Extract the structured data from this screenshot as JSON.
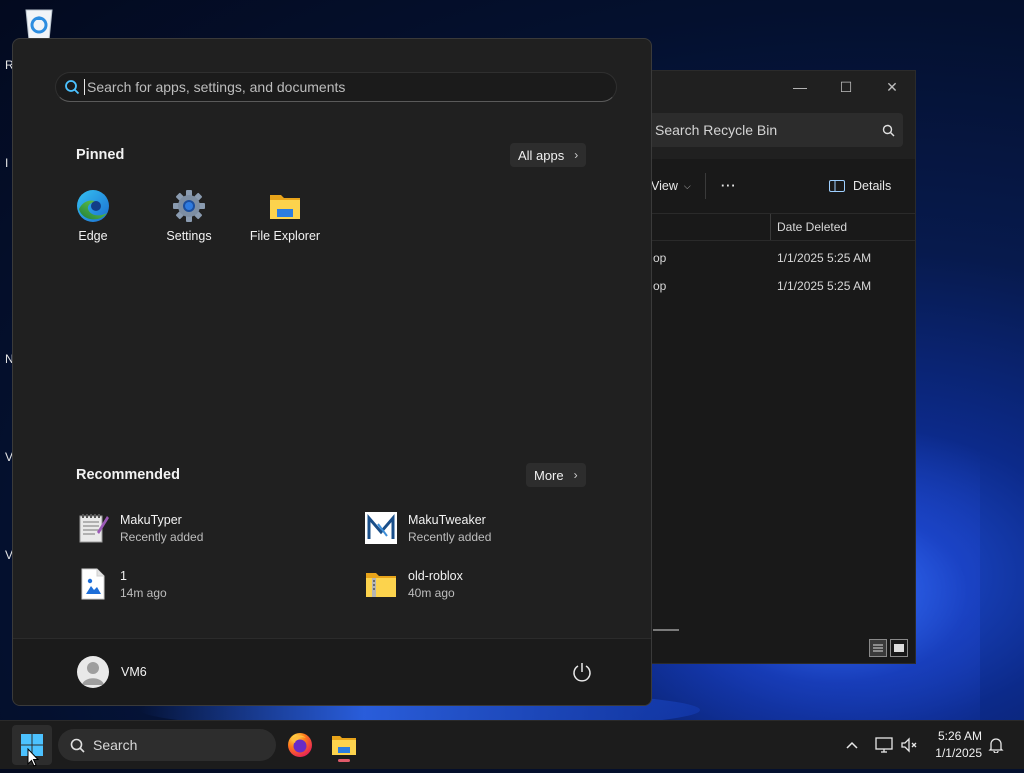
{
  "desktop": {
    "partial_labels": [
      {
        "text": "R",
        "id": "r"
      },
      {
        "text": "I",
        "id": "i"
      },
      {
        "text": "N",
        "id": "n"
      },
      {
        "text": "V",
        "id": "v1"
      },
      {
        "text": "V",
        "id": "v2"
      }
    ]
  },
  "explorer": {
    "window_controls": {
      "minimize": "—",
      "maximize": "☐",
      "close": "✕"
    },
    "search_placeholder": "Search Recycle Bin",
    "view_label": "View",
    "more_label": "···",
    "details_label": "Details",
    "columns": {
      "date_deleted": "Date Deleted"
    },
    "rows": [
      {
        "name_fragment": "op",
        "date_deleted": "1/1/2025 5:25 AM"
      },
      {
        "name_fragment": "op",
        "date_deleted": "1/1/2025 5:25 AM"
      }
    ]
  },
  "start_menu": {
    "search_placeholder": "Search for apps, settings, and documents",
    "pinned_title": "Pinned",
    "all_apps_label": "All apps",
    "pinned": [
      {
        "label": "Edge",
        "icon": "edge-icon"
      },
      {
        "label": "Settings",
        "icon": "settings-gear-icon"
      },
      {
        "label": "File Explorer",
        "icon": "folder-icon"
      }
    ],
    "recommended_title": "Recommended",
    "more_label": "More",
    "recommended": [
      {
        "title": "MakuTyper",
        "subtitle": "Recently added",
        "icon": "notepad-icon"
      },
      {
        "title": "MakuTweaker",
        "subtitle": "Recently added",
        "icon": "makutweaker-icon"
      },
      {
        "title": "1",
        "subtitle": "14m ago",
        "icon": "image-file-icon"
      },
      {
        "title": "old-roblox",
        "subtitle": "40m ago",
        "icon": "zip-folder-icon"
      }
    ],
    "user_name": "VM6"
  },
  "taskbar": {
    "search_label": "Search",
    "apps": [
      {
        "name": "Firefox",
        "icon": "firefox-icon"
      },
      {
        "name": "File Explorer",
        "icon": "file-explorer-icon"
      }
    ],
    "time": "5:26 AM",
    "date": "1/1/2025"
  },
  "colors": {
    "accent": "#4cc2ff",
    "start_bg": "#202020",
    "taskbar_bg": "#1c1c1c"
  }
}
